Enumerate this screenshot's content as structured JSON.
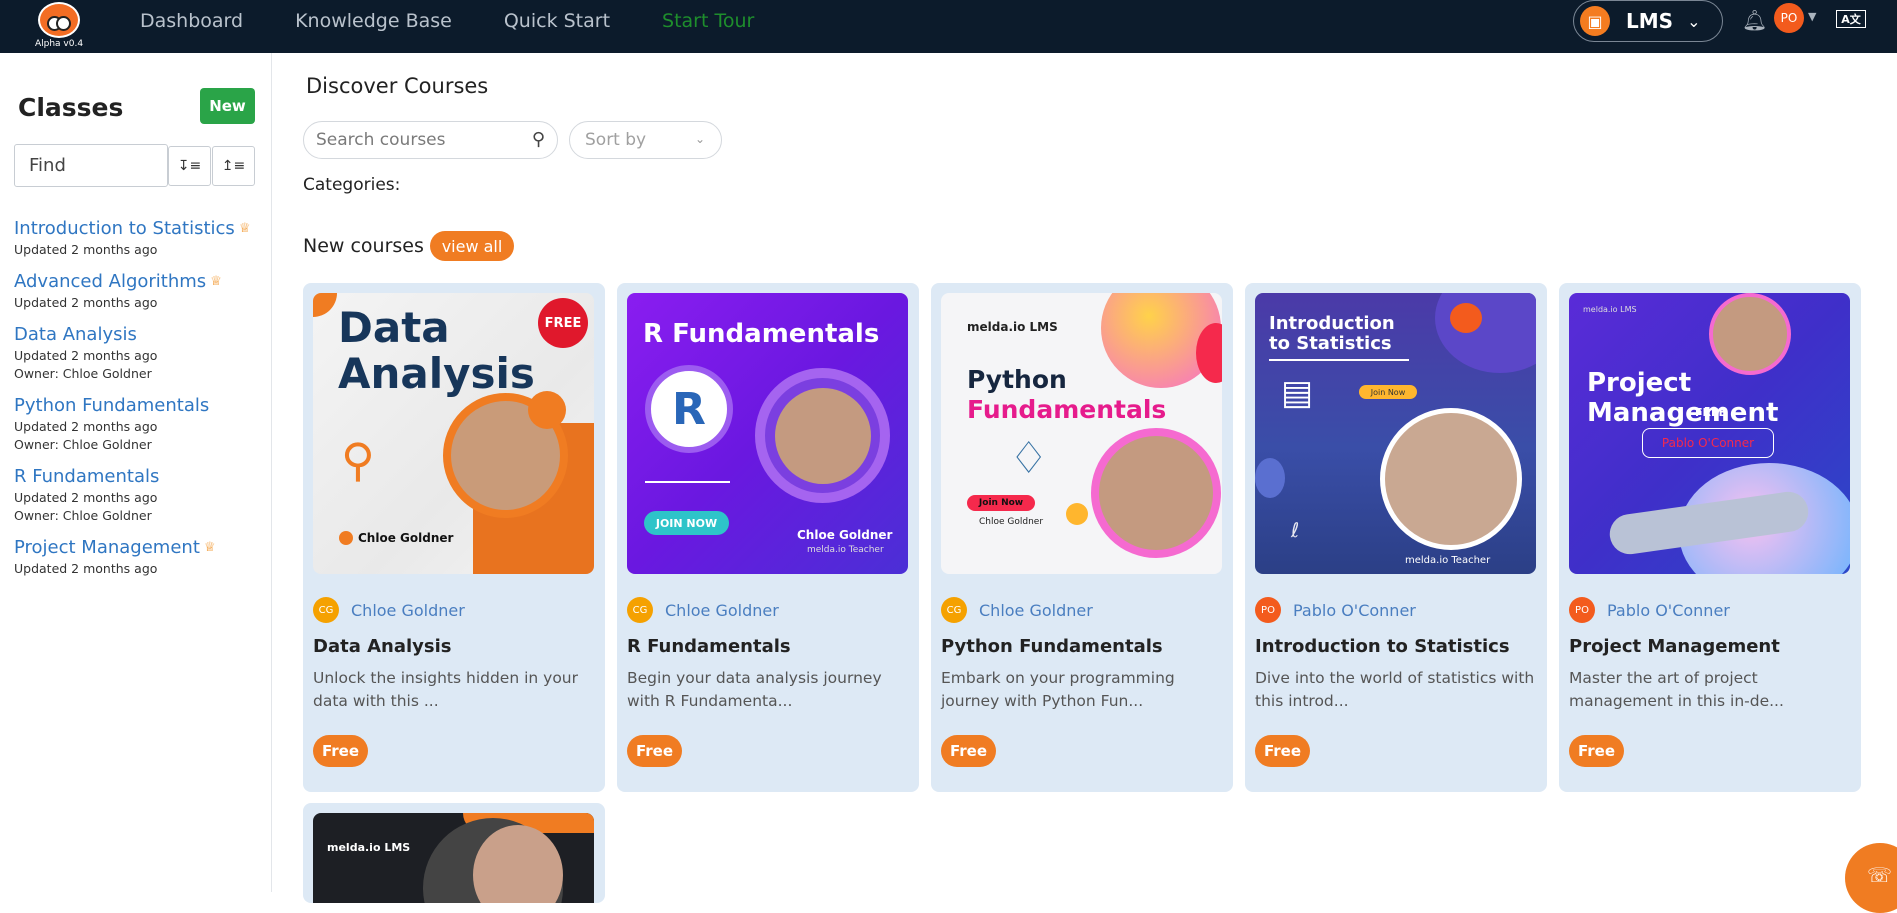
{
  "app": {
    "version": "Alpha v0.4"
  },
  "nav": {
    "items": [
      "Dashboard",
      "Knowledge Base",
      "Quick Start",
      "Start Tour"
    ]
  },
  "header": {
    "lms_label": "LMS",
    "user_initials": "PO",
    "translate_label": "A文"
  },
  "sidebar": {
    "title": "Classes",
    "new_label": "New",
    "find_placeholder": "Find",
    "items": [
      {
        "name": "Introduction to Statistics",
        "updated": "Updated 2 months ago",
        "owner": "",
        "crown": true
      },
      {
        "name": "Advanced Algorithms",
        "updated": "Updated 2 months ago",
        "owner": "",
        "crown": true
      },
      {
        "name": "Data Analysis",
        "updated": "Updated 2 months ago",
        "owner": "Owner: Chloe Goldner",
        "crown": false
      },
      {
        "name": "Python Fundamentals",
        "updated": "Updated 2 months ago",
        "owner": "Owner: Chloe Goldner",
        "crown": false
      },
      {
        "name": "R Fundamentals",
        "updated": "Updated 2 months ago",
        "owner": "Owner: Chloe Goldner",
        "crown": false
      },
      {
        "name": "Project Management",
        "updated": "Updated 2 months ago",
        "owner": "",
        "crown": true
      }
    ]
  },
  "main": {
    "title": "Discover Courses",
    "search_placeholder": "Search courses",
    "sort_placeholder": "Sort by",
    "categories_label": "Categories:",
    "new_courses_label": "New courses",
    "view_all_label": "view all",
    "price_label": "Free"
  },
  "courses": [
    {
      "author": "Chloe Goldner",
      "initials": "CG",
      "avatar_color": "#f5a100",
      "title": "Data Analysis",
      "desc": "Unlock the insights hidden in your data with this ...",
      "thumb_text": {
        "line1": "Data",
        "line2": "Analysis",
        "badge": "FREE",
        "name": "Chloe Goldner"
      }
    },
    {
      "author": "Chloe Goldner",
      "initials": "CG",
      "avatar_color": "#f5a100",
      "title": "R Fundamentals",
      "desc": "Begin your data analysis journey with R Fundamenta...",
      "thumb_text": {
        "line1": "R Fundamentals",
        "cta": "JOIN NOW",
        "name": "Chloe Goldner",
        "role": "melda.io Teacher"
      }
    },
    {
      "author": "Chloe Goldner",
      "initials": "CG",
      "avatar_color": "#f5a100",
      "title": "Python Fundamentals",
      "desc": "Embark on your programming journey with Python Fun...",
      "thumb_text": {
        "brand": "melda.io LMS",
        "line1": "Python",
        "line2": "Fundamentals",
        "cta": "Join Now",
        "name": "Chloe Goldner"
      }
    },
    {
      "author": "Pablo O'Conner",
      "initials": "PO",
      "avatar_color": "#f35b1d",
      "title": "Introduction to Statistics",
      "desc": "Dive into the world of statistics with this introd...",
      "thumb_text": {
        "line1": "Introduction",
        "line2": "to Statistics",
        "cta": "Join Now",
        "name": "Pablo O'Conner",
        "role": "melda.io Teacher"
      }
    },
    {
      "author": "Pablo O'Conner",
      "initials": "PO",
      "avatar_color": "#f35b1d",
      "title": "Project Management",
      "desc": "Master the art of project management in this in-de...",
      "thumb_text": {
        "brand": "melda.io LMS",
        "line1": "Project Management",
        "badge": "FREE",
        "name": "Pablo O'Conner"
      }
    }
  ],
  "partial_course": {
    "brand": "melda.io LMS"
  },
  "colors": {
    "topbar": "#0c1b2b",
    "accent": "#f07c22",
    "link": "#2f76c2",
    "card_bg": "#dde9f5",
    "new_button": "#2aa448",
    "tour": "#1e8e2c"
  }
}
